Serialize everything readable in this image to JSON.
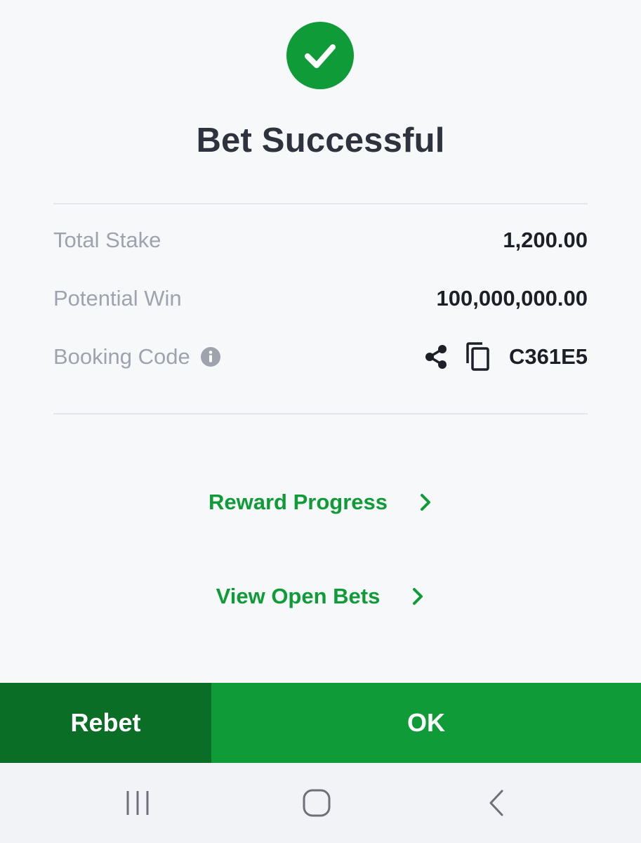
{
  "header": {
    "status_icon": "check-circle-icon",
    "title": "Bet Successful"
  },
  "summary": {
    "total_stake_label": "Total Stake",
    "total_stake_value": "1,200.00",
    "potential_win_label": "Potential Win",
    "potential_win_value": "100,000,000.00",
    "booking_code_label": "Booking Code",
    "booking_code_value": "C361E5",
    "icons": [
      "info-icon",
      "share-icon",
      "copy-icon"
    ]
  },
  "links": {
    "reward_progress": "Reward Progress",
    "view_open_bets": "View Open Bets"
  },
  "actions": {
    "rebet_label": "Rebet",
    "ok_label": "OK"
  },
  "system_nav": {
    "icons": [
      "recent-apps-icon",
      "home-icon",
      "back-icon"
    ]
  },
  "colors": {
    "accent_green": "#0f9b37",
    "dark_green": "#0b6e27",
    "title_text": "#2f333d",
    "muted_label": "#9ea3ad",
    "background": "#f7f8fa"
  }
}
